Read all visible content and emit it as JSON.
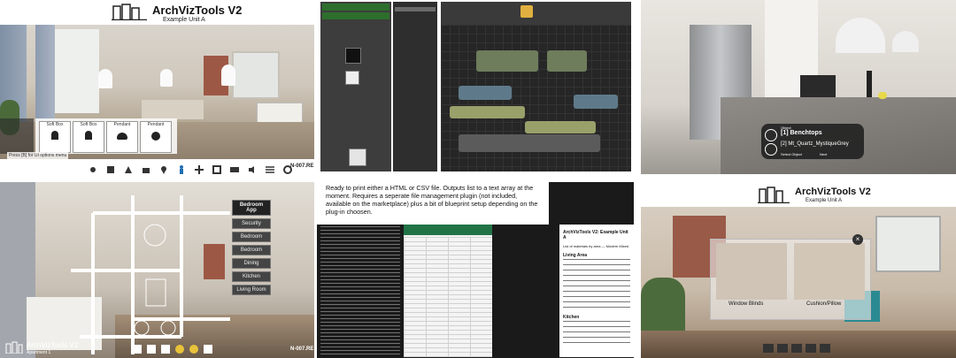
{
  "panel1": {
    "title": "ArchVizTools V2",
    "subtitle": "Example Unit A",
    "bottom_left": "Press [B] for UI options menu",
    "bottom_right": "N-007.RE",
    "cards": [
      {
        "label": "Soft Box"
      },
      {
        "label": "Soft Box"
      },
      {
        "label": "Pendant"
      },
      {
        "label": "Pendant"
      }
    ],
    "toolbar_icons": [
      "sun-icon",
      "cube-icon",
      "brush-icon",
      "camera-icon",
      "pin-icon",
      "person-icon",
      "grid-icon",
      "frame-icon",
      "screen-icon",
      "audio-icon",
      "list-icon",
      "settings-icon"
    ]
  },
  "panel3": {
    "widget_title": "Object",
    "widget_line1": "[1] Benchtops",
    "widget_line2": "[2] Mt_Quartz_MystiqueGrey",
    "widget_prev": "Select Object",
    "widget_next": "Next"
  },
  "panel4": {
    "title": "ArchVizTools V2",
    "subtitle": "Apartment 1",
    "bottom_right": "N-007.RE",
    "menu_header": "Bedroom App",
    "menu_items": [
      "Security",
      "Bedroom",
      "Bedroom",
      "Dining",
      "Kitchen",
      "Living Room"
    ]
  },
  "panel5": {
    "caption": "Ready to print either a HTML or CSV file. Outputs list to a text array at the moment. Requires a seperate file management plugin (not included, available on the marketplace) plus a bit of blueprint setup depending on the plug-in choosen.",
    "doc_title": "ArchVizTools V2: Example Unit A",
    "doc_heading": "List of materials by area — Modern Mixed",
    "sections": [
      {
        "label": "Living Area"
      },
      {
        "label": "Kitchen"
      }
    ]
  },
  "panel6": {
    "title": "ArchVizTools V2",
    "subtitle": "Example Unit A",
    "label_left": "Window Blinds",
    "label_right": "Cushion/Pillow"
  }
}
